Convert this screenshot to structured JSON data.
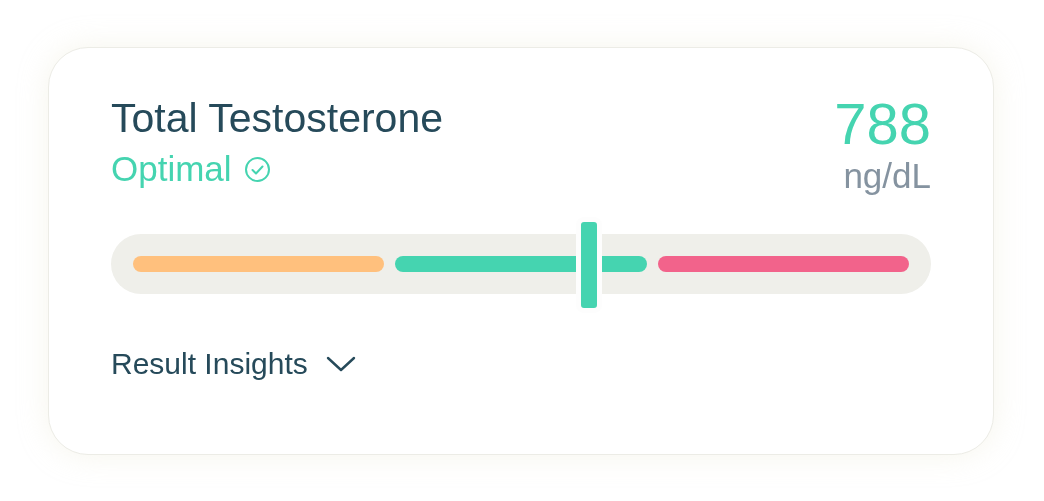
{
  "card": {
    "title": "Total Testosterone",
    "status": "Optimal",
    "value": "788",
    "unit": "ng/dL"
  },
  "range": {
    "segments": [
      {
        "color": "#ffc07d"
      },
      {
        "color": "#45d4b0"
      },
      {
        "color": "#f2638b"
      }
    ],
    "level": 0.587
  },
  "insights": {
    "label": "Result Insights",
    "expanded": false
  }
}
